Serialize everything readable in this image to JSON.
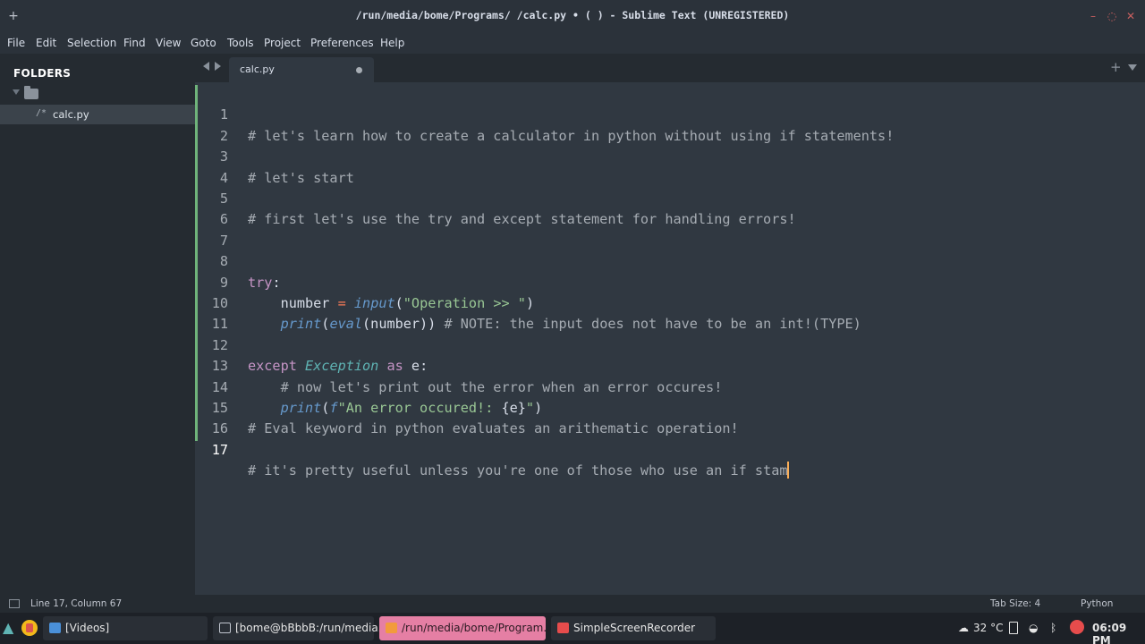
{
  "window": {
    "title": "/run/media/bome/Programs/ /calc.py • ( ) - Sublime Text (UNREGISTERED)",
    "pin_icon": "+",
    "min_icon": "–",
    "max_icon": "◌",
    "close_icon": "✕"
  },
  "menu": [
    "File",
    "Edit",
    "Selection",
    "Find",
    "View",
    "Goto",
    "Tools",
    "Project",
    "Preferences",
    "Help"
  ],
  "sidebar": {
    "header": "FOLDERS",
    "file": {
      "glyph": "/*",
      "name": "calc.py"
    }
  },
  "tabs": [
    {
      "label": "calc.py",
      "modified": true
    }
  ],
  "editor": {
    "line_numbers": [
      "1",
      "2",
      "3",
      "4",
      "5",
      "6",
      "7",
      "8",
      "9",
      "10",
      "11",
      "12",
      "13",
      "14",
      "15",
      "16",
      "17"
    ],
    "active_line": 17,
    "lines": {
      "l1": "# let's learn how to create a calculator in python without using if statements!",
      "l3": "# let's start",
      "l5": "# first let's use the try and except statement for handling errors!",
      "l8_kw": "try",
      "l8_colon": ":",
      "l9_var": "    number ",
      "l9_op": "=",
      "l9_fn": "input",
      "l9_open": "(",
      "l9_str": "\"Operation >> \"",
      "l9_close": ")",
      "l10_fn": "print",
      "l10_open": "(",
      "l10_fn2": "eval",
      "l10_args": "(number)) ",
      "l10_cm": "# NOTE: the input does not have to be an int!(TYPE)",
      "l12_kw": "except",
      "l12_cls": "Exception",
      "l12_as": "as",
      "l12_rest": " e:",
      "l13_cm": "    # now let's print out the error when an error occures!",
      "l14_fn": "print",
      "l14_open": "(",
      "l14_f": "f",
      "l14_str": "\"An error occured!: ",
      "l14_brace": "{e}",
      "l14_end": "\"",
      "l14_close": ")",
      "l15": "# Eval keyword in python evaluates an arithematic operation!",
      "l17": "# it's pretty useful unless you're one of those who use an if stam"
    }
  },
  "status": {
    "position": "Line 17, Column 67",
    "tab_size": "Tab Size: 4",
    "syntax": "Python"
  },
  "taskbar": {
    "tasks": [
      "[Videos]",
      "[bome@bBbbB:/run/media...",
      "/run/media/bome/Program...",
      "SimpleScreenRecorder"
    ],
    "weather_icon": "☁",
    "temperature": "32 °C",
    "wifi_icon": "◒",
    "bluetooth_icon": "ᛒ",
    "time": "06:09 PM"
  },
  "colors": {
    "editor_bg": "#303841",
    "sidebar_bg": "#252b31",
    "comment": "#a6acb3",
    "keyword": "#c594c5",
    "function": "#6699cc",
    "string": "#99c794",
    "modified_bar": "#6fb37a",
    "active_task": "#e57fa4"
  }
}
